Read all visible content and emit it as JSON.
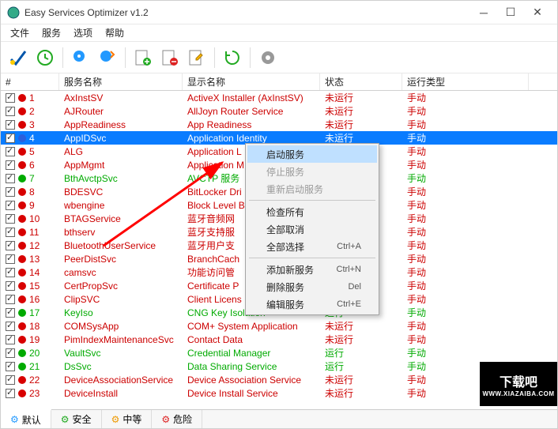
{
  "title": "Easy Services Optimizer v1.2",
  "menu": {
    "file": "文件",
    "services": "服务",
    "options": "选项",
    "help": "帮助"
  },
  "columns": {
    "num": "#",
    "name": "服务名称",
    "disp": "显示名称",
    "state": "状态",
    "startup": "运行类型"
  },
  "state": {
    "not_running": "未运行",
    "running": "运行"
  },
  "startup": {
    "manual": "手动"
  },
  "context": {
    "start": "启动服务",
    "stop": "停止服务",
    "restart": "重新启动服务",
    "check_all": "检查所有",
    "uncheck_all": "全部取消",
    "select_all": "全部选择",
    "select_all_sc": "Ctrl+A",
    "add": "添加新服务",
    "add_sc": "Ctrl+N",
    "delete": "删除服务",
    "delete_sc": "Del",
    "edit": "编辑服务",
    "edit_sc": "Ctrl+E"
  },
  "tabs": {
    "default": "默认",
    "safe": "安全",
    "medium": "中等",
    "danger": "危险"
  },
  "watermark": {
    "t": "下载吧",
    "s": "WWW.XIAZAIBA.COM"
  },
  "rows": [
    {
      "n": "1",
      "name": "AxInstSV",
      "disp": "ActiveX Installer (AxInstSV)",
      "state": "not_running",
      "dot": "red",
      "cls": "red-t",
      "sel": false
    },
    {
      "n": "2",
      "name": "AJRouter",
      "disp": "AllJoyn Router Service",
      "state": "not_running",
      "dot": "red",
      "cls": "red-t",
      "sel": false
    },
    {
      "n": "3",
      "name": "AppReadiness",
      "disp": "App Readiness",
      "state": "not_running",
      "dot": "red",
      "cls": "red-t",
      "sel": false
    },
    {
      "n": "4",
      "name": "AppIDSvc",
      "disp": "Application Identity",
      "state": "not_running",
      "dot": "blue",
      "cls": "blue-t",
      "sel": true
    },
    {
      "n": "5",
      "name": "ALG",
      "disp": "Application L",
      "state": "not_running",
      "dot": "red",
      "cls": "red-t",
      "sel": false
    },
    {
      "n": "6",
      "name": "AppMgmt",
      "disp": "Application M",
      "state": "not_running",
      "dot": "red",
      "cls": "red-t",
      "sel": false
    },
    {
      "n": "7",
      "name": "BthAvctpSvc",
      "disp": "AVCTP 服务",
      "state": "running",
      "dot": "green",
      "cls": "green-t",
      "sel": false
    },
    {
      "n": "8",
      "name": "BDESVC",
      "disp": "BitLocker Dri",
      "state": "not_running",
      "dot": "red",
      "cls": "red-t",
      "sel": false
    },
    {
      "n": "9",
      "name": "wbengine",
      "disp": "Block Level B",
      "state": "not_running",
      "dot": "red",
      "cls": "red-t",
      "sel": false
    },
    {
      "n": "10",
      "name": "BTAGService",
      "disp": "蓝牙音频网",
      "state": "not_running",
      "dot": "red",
      "cls": "red-t",
      "sel": false
    },
    {
      "n": "11",
      "name": "bthserv",
      "disp": "蓝牙支持服",
      "state": "not_running",
      "dot": "red",
      "cls": "red-t",
      "sel": false
    },
    {
      "n": "12",
      "name": "BluetoothUserService",
      "disp": "蓝牙用户支",
      "state": "not_running",
      "dot": "red",
      "cls": "red-t",
      "sel": false
    },
    {
      "n": "13",
      "name": "PeerDistSvc",
      "disp": "BranchCach",
      "state": "not_running",
      "dot": "red",
      "cls": "red-t",
      "sel": false
    },
    {
      "n": "14",
      "name": "camsvc",
      "disp": "功能访问管",
      "state": "not_running",
      "dot": "red",
      "cls": "red-t",
      "sel": false
    },
    {
      "n": "15",
      "name": "CertPropSvc",
      "disp": "Certificate P",
      "state": "not_running",
      "dot": "red",
      "cls": "red-t",
      "sel": false
    },
    {
      "n": "16",
      "name": "ClipSVC",
      "disp": "Client Licens",
      "state": "not_running",
      "dot": "red",
      "cls": "red-t",
      "sel": false
    },
    {
      "n": "17",
      "name": "KeyIso",
      "disp": "CNG Key Isolation",
      "state": "running",
      "dot": "green",
      "cls": "green-t",
      "sel": false
    },
    {
      "n": "18",
      "name": "COMSysApp",
      "disp": "COM+ System Application",
      "state": "not_running",
      "dot": "red",
      "cls": "red-t",
      "sel": false
    },
    {
      "n": "19",
      "name": "PimIndexMaintenanceSvc",
      "disp": "Contact Data",
      "state": "not_running",
      "dot": "red",
      "cls": "red-t",
      "sel": false
    },
    {
      "n": "20",
      "name": "VaultSvc",
      "disp": "Credential Manager",
      "state": "running",
      "dot": "green",
      "cls": "green-t",
      "sel": false
    },
    {
      "n": "21",
      "name": "DsSvc",
      "disp": "Data Sharing Service",
      "state": "running",
      "dot": "green",
      "cls": "green-t",
      "sel": false
    },
    {
      "n": "22",
      "name": "DeviceAssociationService",
      "disp": "Device Association Service",
      "state": "not_running",
      "dot": "red",
      "cls": "red-t",
      "sel": false
    },
    {
      "n": "23",
      "name": "DeviceInstall",
      "disp": "Device Install Service",
      "state": "not_running",
      "dot": "red",
      "cls": "red-t",
      "sel": false
    }
  ]
}
